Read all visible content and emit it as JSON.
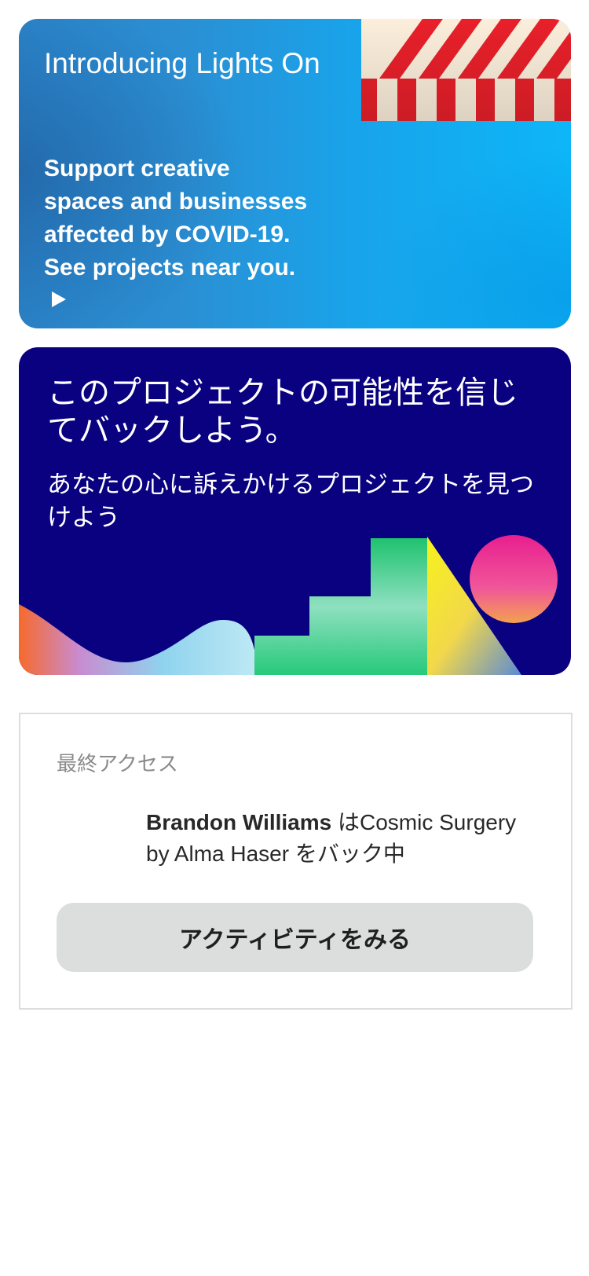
{
  "lights_on_card": {
    "title": "Introducing Lights On",
    "description": "Support creative spaces and businesses affected by COVID-19. See projects near you.",
    "arrow_icon": "play-triangle-icon",
    "colors": {
      "background": "#1aa6ec",
      "awning_red": "#e8202a",
      "awning_cream": "#fbeedb"
    }
  },
  "discover_card": {
    "title": "このプロジェクトの可能性を信じてバックしよう。",
    "subtitle": "あなたの心に訴えかけるプロジェクトを見つけよう",
    "colors": {
      "background": "#0a0180"
    }
  },
  "activity_card": {
    "label": "最終アクセス",
    "user_name": "Brandon Williams",
    "action_text": " はCosmic Surgery by Alma Haser をバック中",
    "button_label": "アクティビティをみる",
    "colors": {
      "button_background": "#dcdedd",
      "border": "#dcdedd"
    }
  }
}
